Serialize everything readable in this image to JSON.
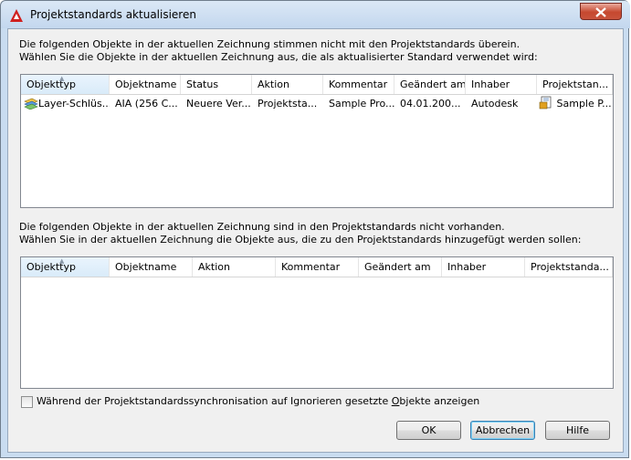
{
  "window": {
    "title": "Projektstandards aktualisieren"
  },
  "section1": {
    "desc_line1": "Die folgenden Objekte in der aktuellen Zeichnung stimmen nicht mit den Projektstandards überein.",
    "desc_line2": "Wählen Sie die Objekte in der aktuellen Zeichnung aus, die als aktualisierter Standard verwendet wird:",
    "columns": [
      "Objekttyp",
      "Objektname",
      "Status",
      "Aktion",
      "Kommentar",
      "Geändert am",
      "Inhaber",
      "Projektstan..."
    ],
    "rows": [
      [
        "Layer-Schlüs...",
        "AIA (256 C...",
        "Neuere Ver...",
        "Projektsta...",
        "Sample Pro...",
        "04.01.200...",
        "Autodesk",
        "Sample P..."
      ]
    ]
  },
  "section2": {
    "desc_line1": "Die folgenden Objekte in der aktuellen Zeichnung sind in den Projektstandards nicht vorhanden.",
    "desc_line2": "Wählen Sie in der aktuellen Zeichnung die Objekte aus, die zu den Projektstandards hinzugefügt werden sollen:",
    "columns": [
      "Objekttyp",
      "Objektname",
      "Aktion",
      "Kommentar",
      "Geändert am",
      "Inhaber",
      "Projektstanda..."
    ]
  },
  "checkbox": {
    "label_pre": "Während der Projektstandardssynchronisation auf Ignorieren gesetzte ",
    "label_u": "O",
    "label_post": "bjekte anzeigen",
    "checked": false
  },
  "buttons": {
    "ok": "OK",
    "cancel": "Abbrechen",
    "help": "Hilfe"
  },
  "icons": {
    "app": "autocad-icon",
    "close": "close-icon",
    "layer": "layer-key-icon",
    "standards": "standards-file-icon"
  },
  "colors": {
    "close_red": "#c6482f",
    "selection_blue": "#d9ebf9"
  }
}
